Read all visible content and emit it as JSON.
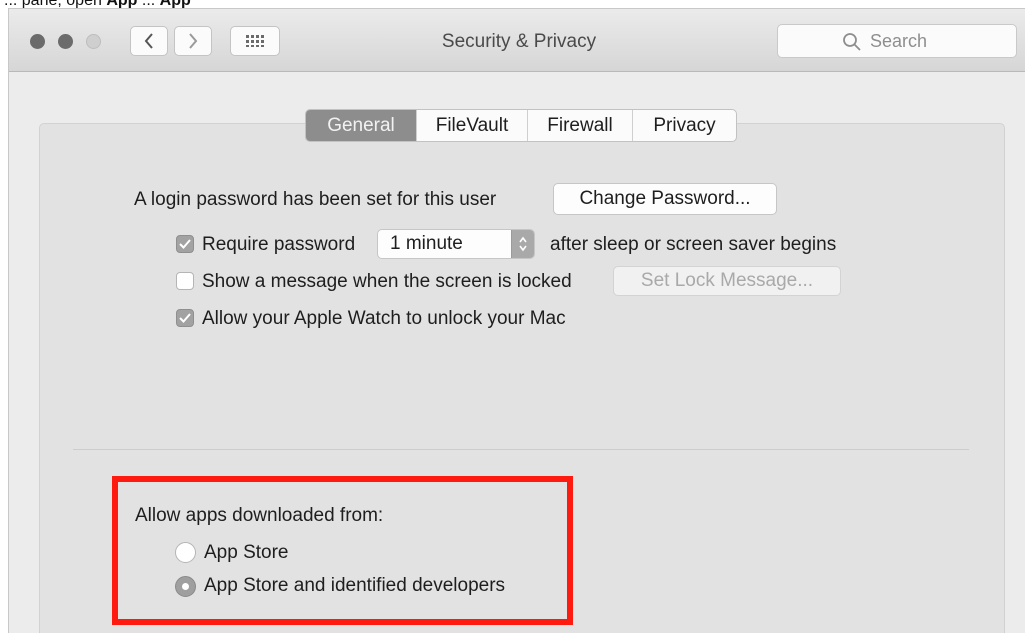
{
  "caption": {
    "prefix": "... pane, open ",
    "bold1": "App",
    "mid": " ... ",
    "bold2": "App"
  },
  "window": {
    "title": "Security & Privacy",
    "search_placeholder": "Search",
    "icons": {
      "back": "chevron-left-icon",
      "forward": "chevron-right-icon",
      "show_all": "grid-icon",
      "search": "magnifier-icon"
    }
  },
  "tabs": [
    {
      "label": "General",
      "selected": true
    },
    {
      "label": "FileVault",
      "selected": false
    },
    {
      "label": "Firewall",
      "selected": false
    },
    {
      "label": "Privacy",
      "selected": false
    }
  ],
  "general": {
    "login_text": "A login password has been set for this user",
    "change_password_label": "Change Password...",
    "require_password": {
      "label": "Require password",
      "checked": true,
      "interval": "1 minute",
      "suffix": "after sleep or screen saver begins"
    },
    "show_message": {
      "label": "Show a message when the screen is locked",
      "checked": false,
      "button_label": "Set Lock Message..."
    },
    "apple_watch": {
      "label": "Allow your Apple Watch to unlock your Mac",
      "checked": true
    },
    "allow_apps": {
      "heading": "Allow apps downloaded from:",
      "options": [
        {
          "label": "App Store",
          "selected": false
        },
        {
          "label": "App Store and identified developers",
          "selected": true
        }
      ]
    }
  },
  "colors": {
    "highlight": "#ff1a10",
    "selected_tab": "#8d8d8d"
  }
}
